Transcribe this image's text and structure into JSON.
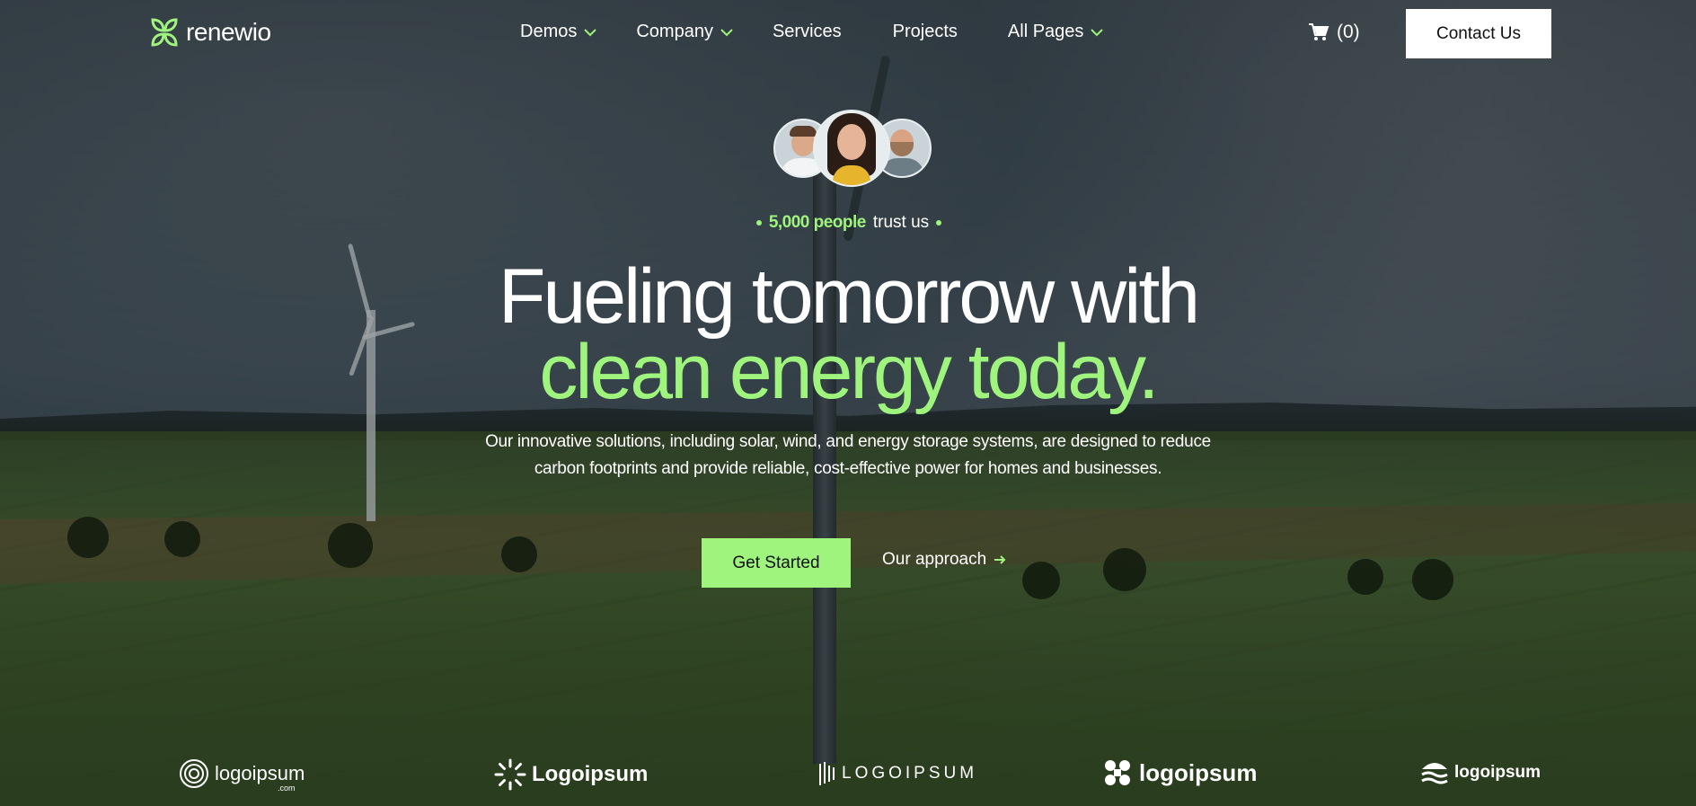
{
  "brand": {
    "name": "renewio",
    "accent": "#9ef47c"
  },
  "nav": {
    "items": [
      {
        "label": "Demos",
        "has_dropdown": true
      },
      {
        "label": "Company",
        "has_dropdown": true
      },
      {
        "label": "Services",
        "has_dropdown": false
      },
      {
        "label": "Projects",
        "has_dropdown": false
      },
      {
        "label": "All Pages",
        "has_dropdown": true
      }
    ],
    "cart_count": "(0)",
    "contact_label": "Contact Us"
  },
  "hero": {
    "trust_strong": "5,000 people",
    "trust_rest": "trust us",
    "headline_line1": "Fueling tomorrow with",
    "headline_line2": "clean energy today.",
    "description": "Our innovative solutions, including solar, wind, and energy storage systems, are designed to reduce carbon footprints and provide reliable, cost-effective power for homes and businesses.",
    "primary_cta": "Get Started",
    "secondary_cta": "Our approach"
  },
  "logos": [
    {
      "text": "logoipsum",
      "sub": ".com"
    },
    {
      "text": "Logoipsum"
    },
    {
      "text": "LOGOIPSUM"
    },
    {
      "text": "logoipsum"
    },
    {
      "text": "logoipsum"
    }
  ]
}
